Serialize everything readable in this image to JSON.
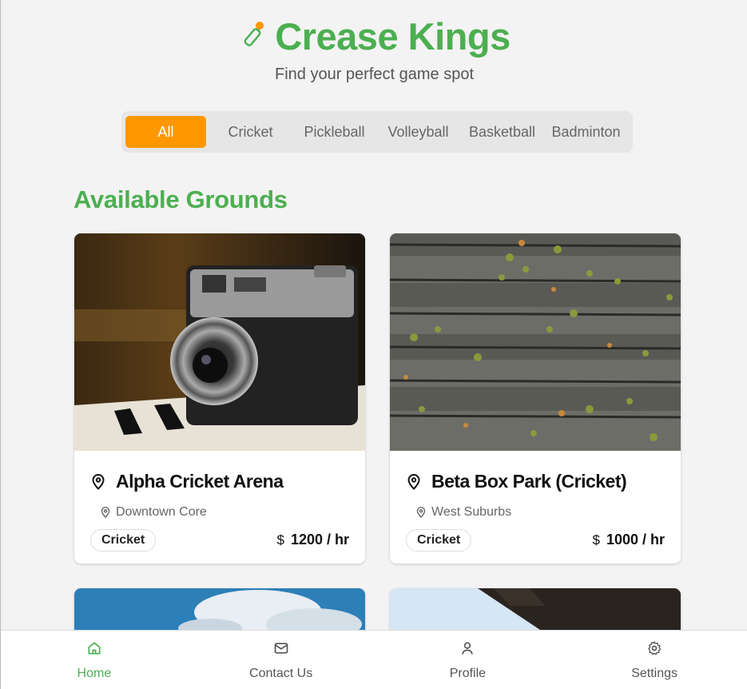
{
  "header": {
    "title": "Crease Kings",
    "tagline": "Find your perfect game spot",
    "logo_icon": "cricket-bat-icon",
    "brand_color": "#4caf50",
    "ball_color": "#ff9800"
  },
  "filters": {
    "tabs": [
      "All",
      "Cricket",
      "Pickleball",
      "Volleyball",
      "Basketball",
      "Badminton"
    ],
    "active": "All",
    "active_color": "#ff9800"
  },
  "section": {
    "title": "Available Grounds"
  },
  "grounds": [
    {
      "name": "Alpha Cricket Arena",
      "location": "Downtown Core",
      "sport": "Cricket",
      "currency": "$",
      "price": "1200 / hr",
      "image": "vintage-camera-on-piano-photo"
    },
    {
      "name": "Beta Box Park (Cricket)",
      "location": "West Suburbs",
      "sport": "Cricket",
      "currency": "$",
      "price": "1000 / hr",
      "image": "wooden-planks-with-leaves-photo"
    },
    {
      "image": "blue-sky-clouds-photo"
    },
    {
      "image": "sky-with-roof-photo"
    }
  ],
  "bottom_nav": [
    {
      "label": "Home",
      "icon": "home-icon",
      "active": true
    },
    {
      "label": "Contact Us",
      "icon": "mail-icon",
      "active": false
    },
    {
      "label": "Profile",
      "icon": "user-icon",
      "active": false
    },
    {
      "label": "Settings",
      "icon": "gear-icon",
      "active": false
    }
  ]
}
